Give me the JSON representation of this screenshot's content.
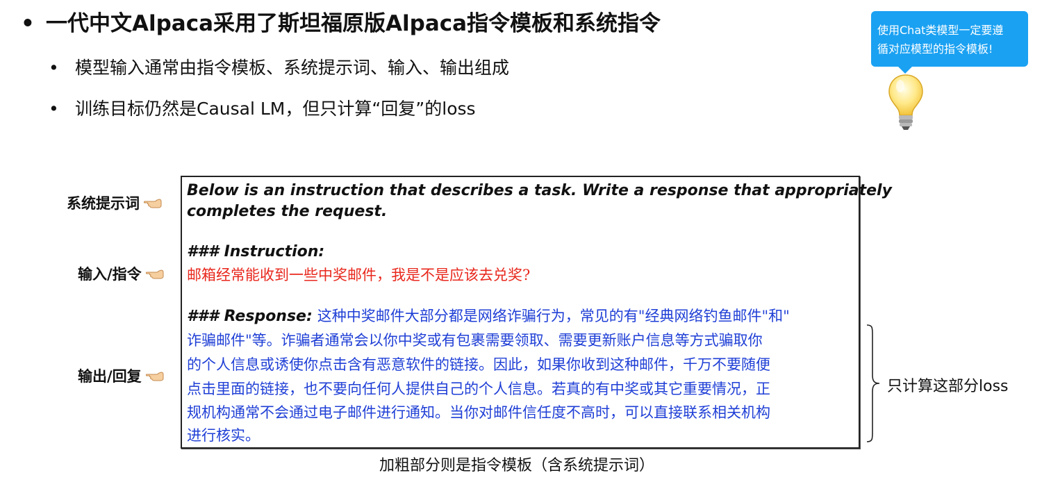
{
  "heading": {
    "bullet": "•",
    "text": "一代中文Alpaca采用了斯坦福原版Alpaca指令模板和系统指令"
  },
  "sub_bullets": [
    {
      "bullet": "•",
      "text": "模型输入通常由指令模板、系统提示词、输入、输出组成"
    },
    {
      "bullet": "•",
      "text": "训练目标仍然是Causal LM，但只计算“回复”的loss"
    }
  ],
  "callout": {
    "line1": "使用Chat类模型一定要遵",
    "line2": "循对应模型的指令模板!",
    "background_color": "#1aa1f2",
    "icon": "lightbulb-icon"
  },
  "side_labels": {
    "system": "系统提示词",
    "input": "输入/指令",
    "output": "输出/回复",
    "icon": "pointing-hand-icon"
  },
  "template": {
    "system_line1": "Below is an instruction that describes a task. Write a response that appropriately",
    "system_line2": "completes the request.",
    "instruction_header": "### Instruction:",
    "instruction_text": "邮箱经常能收到一些中奖邮件，我是不是应该去兑奖?",
    "response_header": "### Response:",
    "response_lines": [
      "这种中奖邮件大部分都是网络诈骗行为，常见的有\"经典网络钓鱼邮件\"和\"",
      "诈骗邮件\"等。诈骗者通常会以你中奖或有包裹需要领取、需要更新账户信息等方式骗取你",
      "的个人信息或诱使你点击含有恶意软件的链接。因此，如果你收到这种邮件，千万不要随便",
      "点击里面的链接，也不要向任何人提供自己的个人信息。若真的有中奖或其它重要情况，正",
      "规机构通常不会通过电子邮件进行通知。当你对邮件信任度不高时，可以直接联系相关机构",
      "进行核实。"
    ],
    "colors": {
      "instruction": "#e8271c",
      "response": "#1f3fd6"
    }
  },
  "brace_label": "只计算这部分loss",
  "caption": "加粗部分则是指令模板（含系统提示词）"
}
